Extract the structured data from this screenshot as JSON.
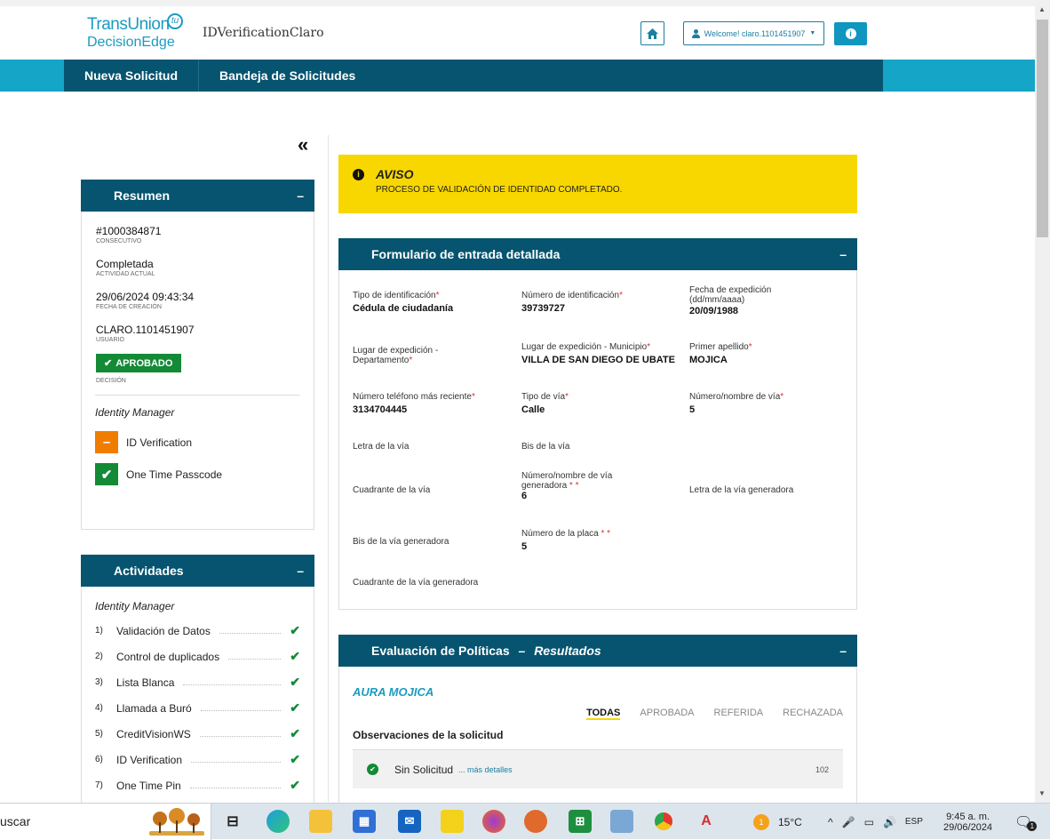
{
  "header": {
    "logo_line1": "TransUnion",
    "logo_line2": "DecisionEdge",
    "logo_badge": "tu",
    "app_title": "IDVerificationClaro",
    "welcome": "Welcome! claro.1101451907",
    "home_icon": "home-icon",
    "info_icon": "info-icon"
  },
  "nav": {
    "items": [
      "Nueva Solicitud",
      "Bandeja de Solicitudes"
    ]
  },
  "resumen": {
    "title": "Resumen",
    "toggle": "–",
    "consecutivo_value": "#1000384871",
    "consecutivo_label": "CONSECUTIVO",
    "actividad_value": "Completada",
    "actividad_label": "ACTIVIDAD ACTUAL",
    "fecha_value": "29/06/2024 09:43:34",
    "fecha_label": "FECHA DE CREACIÓN",
    "usuario_value": "CLARO.1101451907",
    "usuario_label": "USUARIO",
    "decision_value": "APROBADO",
    "decision_label": "DECISIÓN",
    "section": "Identity Manager",
    "modules": [
      {
        "label": "ID Verification",
        "status": "–",
        "color": "#f07d00"
      },
      {
        "label": "One Time Passcode",
        "status": "✔",
        "color": "#138a36"
      }
    ]
  },
  "actividades": {
    "title": "Actividades",
    "toggle": "–",
    "section": "Identity Manager",
    "items": [
      {
        "n": "1)",
        "label": "Validación de Datos"
      },
      {
        "n": "2)",
        "label": "Control de duplicados"
      },
      {
        "n": "3)",
        "label": "Lista Blanca"
      },
      {
        "n": "4)",
        "label": "Llamada a Buró"
      },
      {
        "n": "5)",
        "label": "CreditVisionWS"
      },
      {
        "n": "6)",
        "label": "ID Verification"
      },
      {
        "n": "7)",
        "label": "One Time Pin"
      }
    ]
  },
  "aviso": {
    "title": "AVISO",
    "message": "PROCESO DE VALIDACIÓN DE IDENTIDAD COMPLETADO."
  },
  "formulario": {
    "title": "Formulario de entrada detallada",
    "toggle": "–",
    "fields": {
      "tipo_id": {
        "label": "Tipo de identificación",
        "value": "Cédula de ciudadanía"
      },
      "num_id": {
        "label": "Número de identificación",
        "value": "39739727"
      },
      "fecha_exp_1": "Fecha de expedición",
      "fecha_exp_2": "(dd/mm/aaaa)",
      "fecha_exp_value": "20/09/1988",
      "lugar_dep_1": "Lugar de expedición -",
      "lugar_dep_2": "Departamento",
      "lugar_mun": {
        "label": "Lugar de expedición - Municipio",
        "value": "VILLA DE SAN DIEGO DE UBATE"
      },
      "apellido": {
        "label": "Primer apellido",
        "value": "MOJICA"
      },
      "telefono": {
        "label": "Número teléfono más reciente",
        "value": "3134704445"
      },
      "tipo_via": {
        "label": "Tipo de vía",
        "value": "Calle"
      },
      "num_via": {
        "label": "Número/nombre de vía",
        "value": "5"
      },
      "letra_via": "Letra de la vía",
      "bis_via": "Bis de la vía",
      "cuadrante": "Cuadrante de la vía",
      "num_gen_1": "Número/nombre de vía",
      "num_gen_2": "generadora",
      "num_gen_value": "6",
      "letra_gen": "Letra de la vía generadora",
      "bis_gen": "Bis de la vía generadora",
      "placa": {
        "label": "Número de la placa",
        "value": "5"
      },
      "cuadrante_gen": "Cuadrante de la vía generadora"
    }
  },
  "evaluacion": {
    "title": "Evaluación de Políticas",
    "dash": "–",
    "subtitle": "Resultados",
    "toggle": "–",
    "name": "AURA MOJICA",
    "tabs": [
      "TODAS",
      "APROBADA",
      "REFERIDA",
      "RECHAZADA"
    ],
    "observaciones": "Observaciones de la solicitud",
    "row_label": "Sin Solicitud",
    "row_more": "... más detalles",
    "row_num": "102"
  },
  "taskbar": {
    "search": "uscar",
    "temperature": "15°C",
    "lang": "ESP",
    "time": "9:45 a. m.",
    "date": "29/06/2024",
    "notif_count": "1",
    "weather_badge": "1"
  }
}
